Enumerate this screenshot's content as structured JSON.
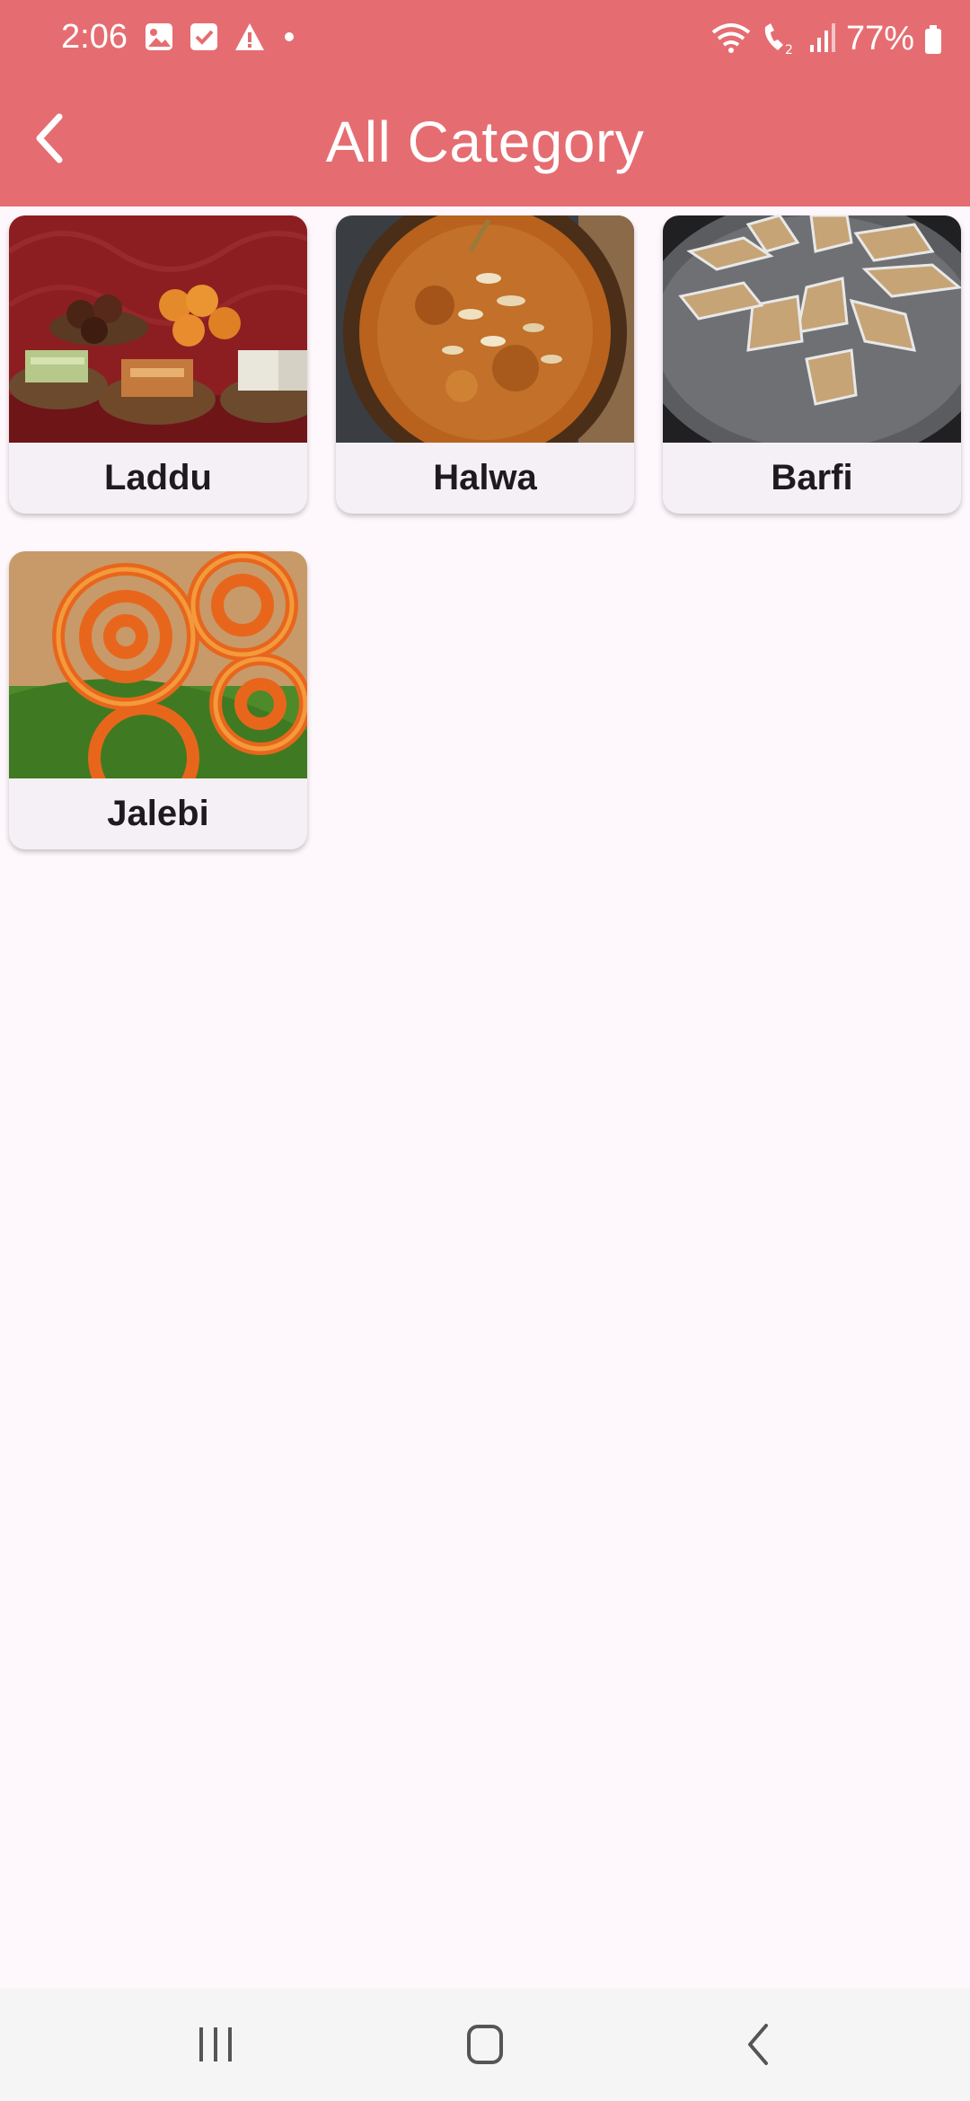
{
  "status_bar": {
    "time": "2:06",
    "battery": "77%",
    "left_icons": [
      "image-icon",
      "checkbox-icon",
      "warning-icon",
      "dot-icon"
    ],
    "right_icons": [
      "wifi-icon",
      "volte-call-icon",
      "signal-icon",
      "battery-icon"
    ]
  },
  "header": {
    "title": "All Category",
    "back_icon": "chevron-left-icon",
    "background": "#e56d71"
  },
  "categories": [
    {
      "label": "Laddu",
      "image": "assorted Indian sweets platter"
    },
    {
      "label": "Halwa",
      "image": "halwa bowl with nuts"
    },
    {
      "label": "Barfi",
      "image": "kaju katli diamonds on plate"
    },
    {
      "label": "Jalebi",
      "image": "jalebi on banana leaf"
    }
  ],
  "nav_bar": {
    "buttons": [
      "recents-icon",
      "home-icon",
      "back-icon"
    ]
  }
}
